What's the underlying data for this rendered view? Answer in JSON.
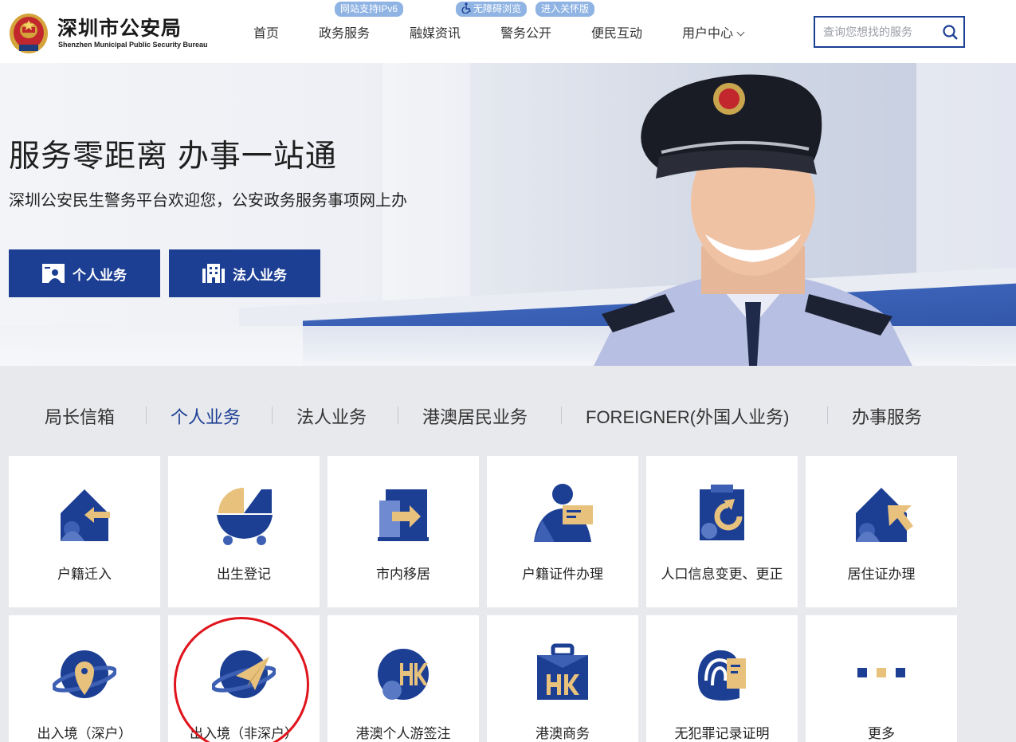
{
  "header": {
    "title": "深圳市公安局",
    "subtitle": "Shenzhen Municipal Public Security Bureau",
    "nav": [
      "首页",
      "政务服务",
      "融媒资讯",
      "警务公开",
      "便民互动",
      "用户中心"
    ],
    "pills": {
      "ipv6": "网站支持IPv6",
      "accessible": "无障碍浏览",
      "care": "进入关怀版"
    },
    "search_placeholder": "查询您想找的服务"
  },
  "hero": {
    "title": "服务零距离 办事一站通",
    "subtitle": "深圳公安民生警务平台欢迎您，公安政务服务事项网上办",
    "btn_personal": "个人业务",
    "btn_legal": "法人业务"
  },
  "tabs": [
    "局长信箱",
    "个人业务",
    "法人业务",
    "港澳居民业务",
    "FOREIGNER(外国人业务)",
    "办事服务"
  ],
  "active_tab": "个人业务",
  "services": [
    {
      "label": "户籍迁入",
      "icon": "house-arrow-icon"
    },
    {
      "label": "出生登记",
      "icon": "cradle-icon"
    },
    {
      "label": "市内移居",
      "icon": "door-arrow-icon"
    },
    {
      "label": "户籍证件办理",
      "icon": "person-card-icon"
    },
    {
      "label": "人口信息变更、更正",
      "icon": "clipboard-refresh-icon"
    },
    {
      "label": "居住证办理",
      "icon": "house-cursor-icon"
    },
    {
      "label": "出入境（深户）",
      "icon": "planet-pin-icon"
    },
    {
      "label": "出入境（非深户）",
      "icon": "planet-plane-icon"
    },
    {
      "label": "港澳个人游签注",
      "icon": "hk-circle-icon"
    },
    {
      "label": "港澳商务",
      "icon": "hk-briefcase-icon"
    },
    {
      "label": "无犯罪记录证明",
      "icon": "fingerprint-doc-icon"
    },
    {
      "label": "更多",
      "icon": "more-dots-icon"
    }
  ],
  "colors": {
    "brand": "#1c3f94",
    "accent": "#e8c27c",
    "highlight_circle": "#e0141c"
  }
}
